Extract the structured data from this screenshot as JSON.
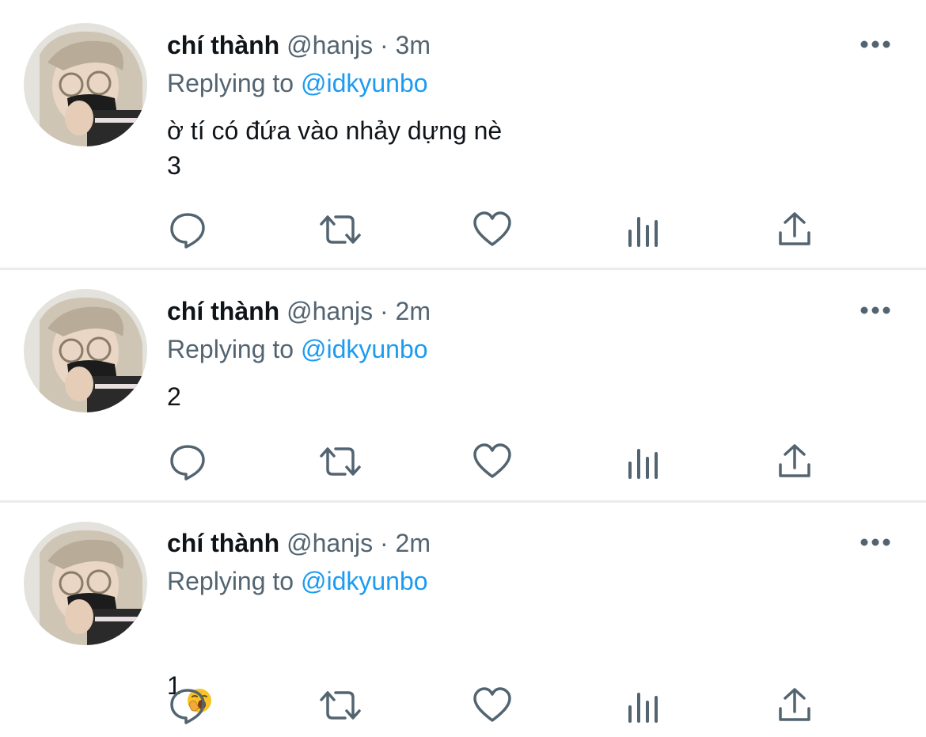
{
  "colors": {
    "text": "#0f1419",
    "secondary": "#536471",
    "link": "#1d9bf0",
    "divider": "#e9ebed"
  },
  "tweets": [
    {
      "name": "chí thành",
      "handle": "@hanjs",
      "separator": "·",
      "time": "3m",
      "replying_label": "Replying to",
      "replying_to": "@idkyunbo",
      "text": "ờ tí có đứa vào nhảy dựng nè\n3"
    },
    {
      "name": "chí thành",
      "handle": "@hanjs",
      "separator": "·",
      "time": "2m",
      "replying_label": "Replying to",
      "replying_to": "@idkyunbo",
      "text": "2"
    },
    {
      "name": "chí thành",
      "handle": "@hanjs",
      "separator": "·",
      "time": "2m",
      "replying_label": "Replying to",
      "replying_to": "@idkyunbo",
      "text": "1",
      "emoji": "yawning-face-emoji"
    }
  ],
  "icons": {
    "more": "more-horizontal-icon",
    "reply": "comment-icon",
    "retweet": "retweet-icon",
    "like": "heart-icon",
    "views": "analytics-icon",
    "share": "share-icon"
  }
}
